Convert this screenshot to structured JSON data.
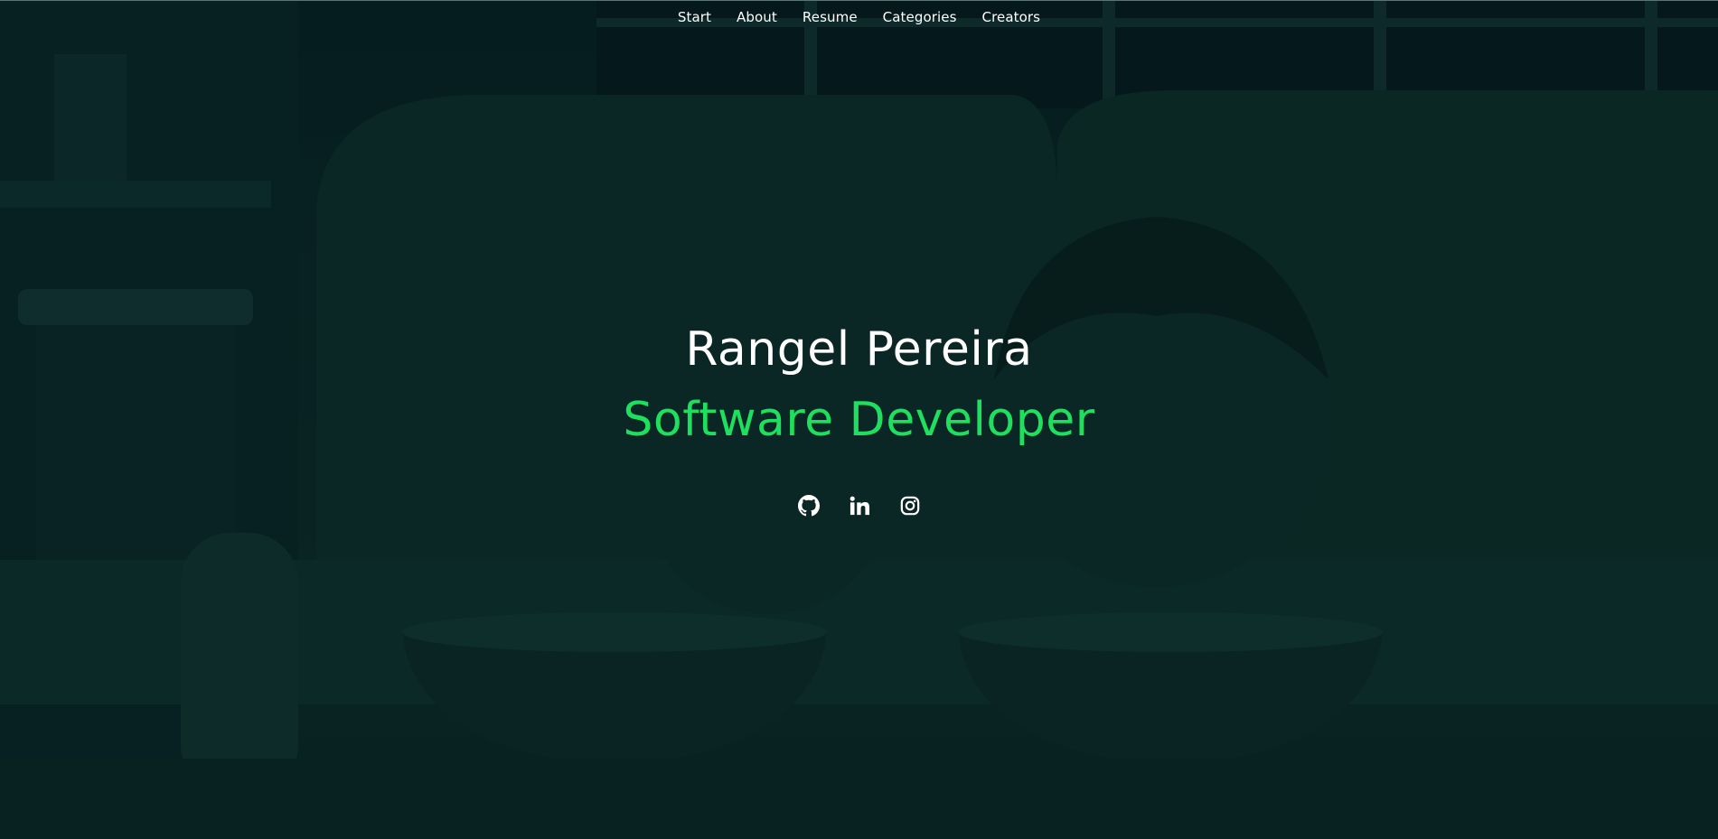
{
  "nav": {
    "items": [
      {
        "label": "Start"
      },
      {
        "label": "About"
      },
      {
        "label": "Resume"
      },
      {
        "label": "Categories"
      },
      {
        "label": "Creators"
      }
    ]
  },
  "hero": {
    "name": "Rangel Pereira",
    "role": "Software Developer"
  },
  "social": [
    {
      "icon": "github-icon"
    },
    {
      "icon": "linkedin-icon"
    },
    {
      "icon": "instagram-icon"
    }
  ],
  "colors": {
    "accent": "#1ee05e",
    "text": "#ffffff",
    "background": "#0b2a2c"
  }
}
